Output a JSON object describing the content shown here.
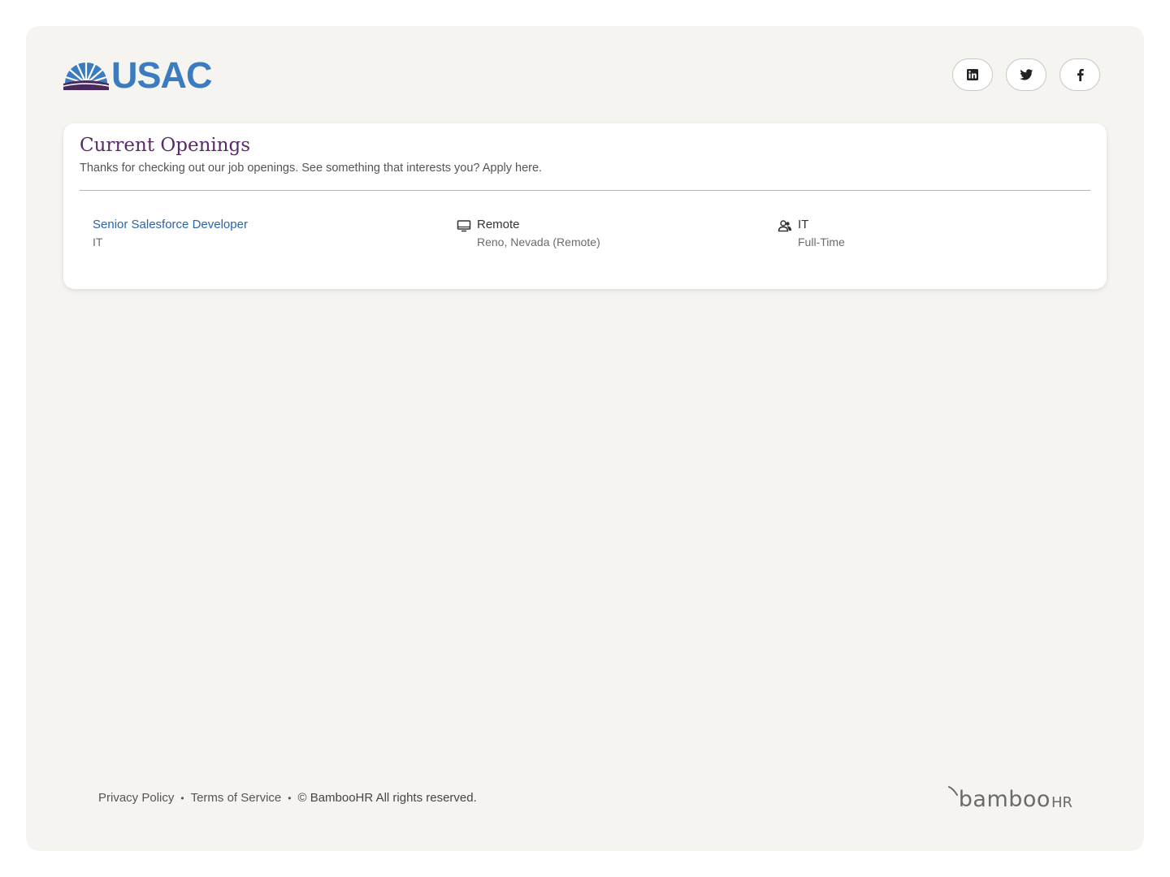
{
  "header": {
    "logo_text": "USAC",
    "social": [
      {
        "name": "linkedin-icon"
      },
      {
        "name": "twitter-icon"
      },
      {
        "name": "facebook-icon"
      }
    ]
  },
  "openings": {
    "title": "Current Openings",
    "subtitle": "Thanks for checking out our job openings. See something that interests you? Apply here.",
    "jobs": [
      {
        "title": "Senior Salesforce Developer",
        "department": "IT",
        "location_type": "Remote",
        "location": "Reno, Nevada (Remote)",
        "team": "IT",
        "employment_type": "Full-Time",
        "location_icon": "monitor-icon",
        "team_icon": "people-icon"
      }
    ]
  },
  "footer": {
    "privacy": "Privacy Policy",
    "terms": "Terms of Service",
    "copyright": "© BambooHR All rights reserved.",
    "brand_word": "bamboo",
    "brand_hr": "HR"
  },
  "colors": {
    "frame_bg": "#f5f4f1",
    "title": "#5a2a66",
    "link": "#2a65a8",
    "logo_blue": "#3b7cc0"
  }
}
